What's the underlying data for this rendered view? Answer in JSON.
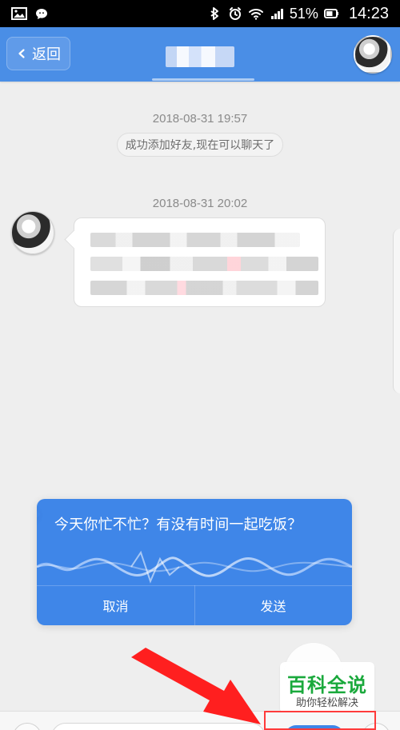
{
  "status_bar": {
    "battery_percent": "51%",
    "time": "14:23",
    "icons": [
      "gallery-icon",
      "wechat-icon",
      "bluetooth-icon",
      "alarm-icon",
      "wifi-icon",
      "signal-icon",
      "battery-icon"
    ]
  },
  "top_bar": {
    "back_label": "返回",
    "accent_color": "#4a8ee6"
  },
  "chat": {
    "timestamps": [
      "2018-08-31 19:57",
      "2018-08-31 20:02"
    ],
    "system_message": "成功添加好友,现在可以聊天了"
  },
  "voice_panel": {
    "recognized_text": "今天你忙不忙？有没有时间一起吃饭？",
    "cancel_label": "取消",
    "send_label": "发送",
    "panel_color": "#3f86e8"
  },
  "watermark": {
    "title": "百科全说",
    "subtitle": "助你轻松解决",
    "title_color": "#1aa93c"
  },
  "annotation": {
    "highlight_color": "#ff3b3b"
  }
}
